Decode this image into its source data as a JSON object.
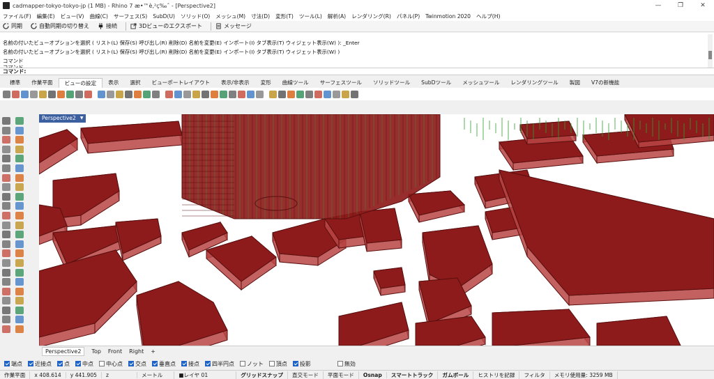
{
  "window": {
    "title": "cadmapper-tokyo-tokyo-jp (1 MB) - Rhino 7 æ•™è‚²ç‰ˆ - [Perspective2]",
    "controls": [
      "—",
      "❐",
      "✕"
    ]
  },
  "menu": [
    "ファイル(F)",
    "編集(E)",
    "ビュー(V)",
    "曲線(C)",
    "サーフェス(S)",
    "SubD(U)",
    "ソリッド(O)",
    "メッシュ(M)",
    "寸法(D)",
    "変形(T)",
    "ツール(L)",
    "解析(A)",
    "レンダリング(R)",
    "パネル(P)",
    "Twinmotion 2020",
    "ヘルプ(H)"
  ],
  "command_toolbar": {
    "sync": "同期",
    "auto_sync": "自動同期の切り替え",
    "connect": "接続",
    "export_3d": "3Dビューのエクスポート",
    "message": "メッセージ"
  },
  "history": [
    "名前の付いたビューオプションを選択 ( リスト(L)  保存(S)  呼び出し(R)  削除(D)  名前を変更(E)  インポート(I)  タブ表示(T)  ウィジェット表示(W) ): _Enter",
    "名前の付いたビューオプションを選択 ( リスト(L)  保存(S)  呼び出し(R)  削除(D)  名前を変更(E)  インポート(I)  タブ表示(T)  ウィジェット表示(W) )",
    "コマンド",
    "コマンド"
  ],
  "prompt": "コマンド:",
  "toolbar_tabs": [
    "標準",
    "作業平面",
    "ビューの設定",
    "表示",
    "選択",
    "ビューポートレイアウト",
    "表示/非表示",
    "変形",
    "曲線ツール",
    "サーフェスツール",
    "ソリッドツール",
    "SubDツール",
    "メッシュツール",
    "レンダリングツール",
    "製図",
    "V7の新機能"
  ],
  "active_toolbar_tab": "ビューの設定",
  "viewport": {
    "label": "Perspective2",
    "tabs": [
      "Perspective2",
      "Top",
      "Front",
      "Right",
      "+"
    ],
    "colors": {
      "building": "#8e1b1b",
      "edge": "#5a0f0f",
      "grid": "#2f9c2f"
    }
  },
  "osnaps": [
    {
      "label": "端点",
      "on": true
    },
    {
      "label": "近接点",
      "on": true
    },
    {
      "label": "点",
      "on": true
    },
    {
      "label": "中点",
      "on": true
    },
    {
      "label": "中心点",
      "on": false
    },
    {
      "label": "交点",
      "on": true
    },
    {
      "label": "垂直点",
      "on": true
    },
    {
      "label": "接点",
      "on": true
    },
    {
      "label": "四半円点",
      "on": true
    },
    {
      "label": "ノット",
      "on": false
    },
    {
      "label": "頂点",
      "on": false
    },
    {
      "label": "投影",
      "on": true
    },
    {
      "label": "無効",
      "on": false
    }
  ],
  "status": {
    "cplane": "作業平面",
    "x": "x 408.614",
    "y": "y 441.905",
    "z": "z",
    "unit": "メートル",
    "layer": "■レイヤ 01",
    "gridsnap": "グリッドスナップ",
    "ortho": "直交モード",
    "planar": "平面モード",
    "osnap": "Osnap",
    "smarttrack": "スマートトラック",
    "gumball": "ガムボール",
    "history": "ヒストリを記録",
    "filter": "フィルタ",
    "memory": "メモリ使用量: 3259 MB"
  }
}
